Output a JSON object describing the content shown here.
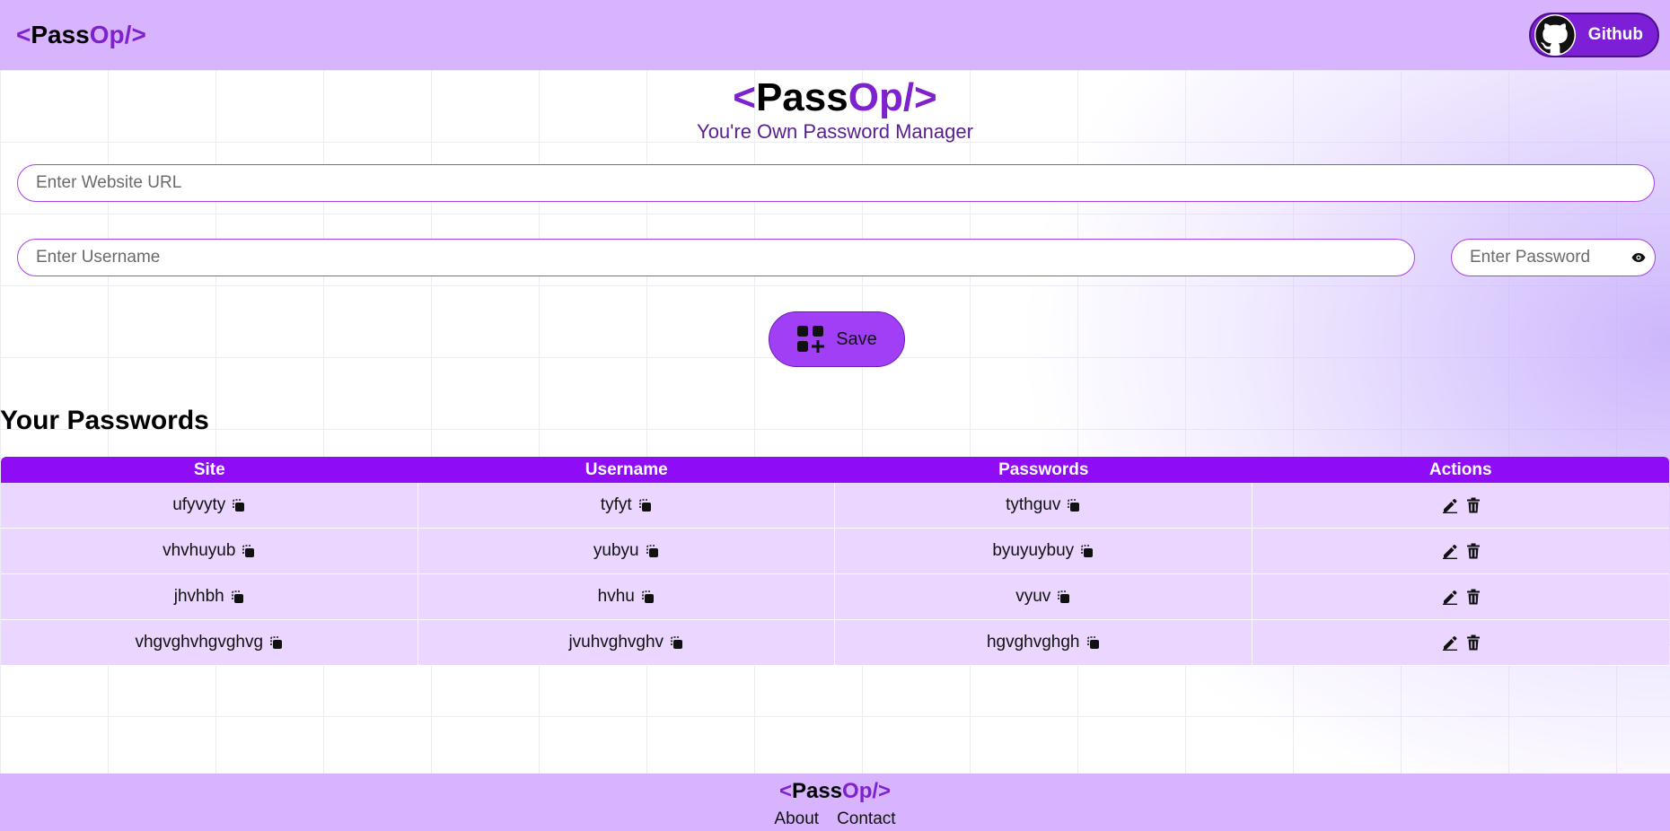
{
  "brand": {
    "open": "<",
    "pass": "Pass",
    "op": "Op/",
    "close": ">"
  },
  "header": {
    "github_label": "Github"
  },
  "hero": {
    "tagline": "You're Own Password Manager"
  },
  "form": {
    "url_placeholder": "Enter Website URL",
    "username_placeholder": "Enter Username",
    "password_placeholder": "Enter Password",
    "save_label": "Save"
  },
  "passwords": {
    "title": "Your Passwords",
    "columns": [
      "Site",
      "Username",
      "Passwords",
      "Actions"
    ],
    "rows": [
      {
        "site": "ufyvyty",
        "username": "tyfyt",
        "password": "tythguv"
      },
      {
        "site": "vhvhuyub",
        "username": "yubyu",
        "password": "byuyuybuy"
      },
      {
        "site": "jhvhbh",
        "username": "hvhu",
        "password": "vyuv"
      },
      {
        "site": "vhgvghvhgvghvg",
        "username": "jvuhvghvghv",
        "password": "hgvghvghgh"
      }
    ]
  },
  "footer": {
    "about": "About",
    "contact": "Contact"
  },
  "icons": {
    "github": "github-icon",
    "eye": "eye-icon",
    "save": "add-grid-icon",
    "copy": "copy-icon",
    "edit": "edit-icon",
    "delete": "trash-icon"
  },
  "colors": {
    "nav_bg": "#d9b4fe",
    "accent": "#7e22ce",
    "table_header": "#8f0df5",
    "table_row": "#ead6fe",
    "save_btn": "#a13ff6"
  }
}
